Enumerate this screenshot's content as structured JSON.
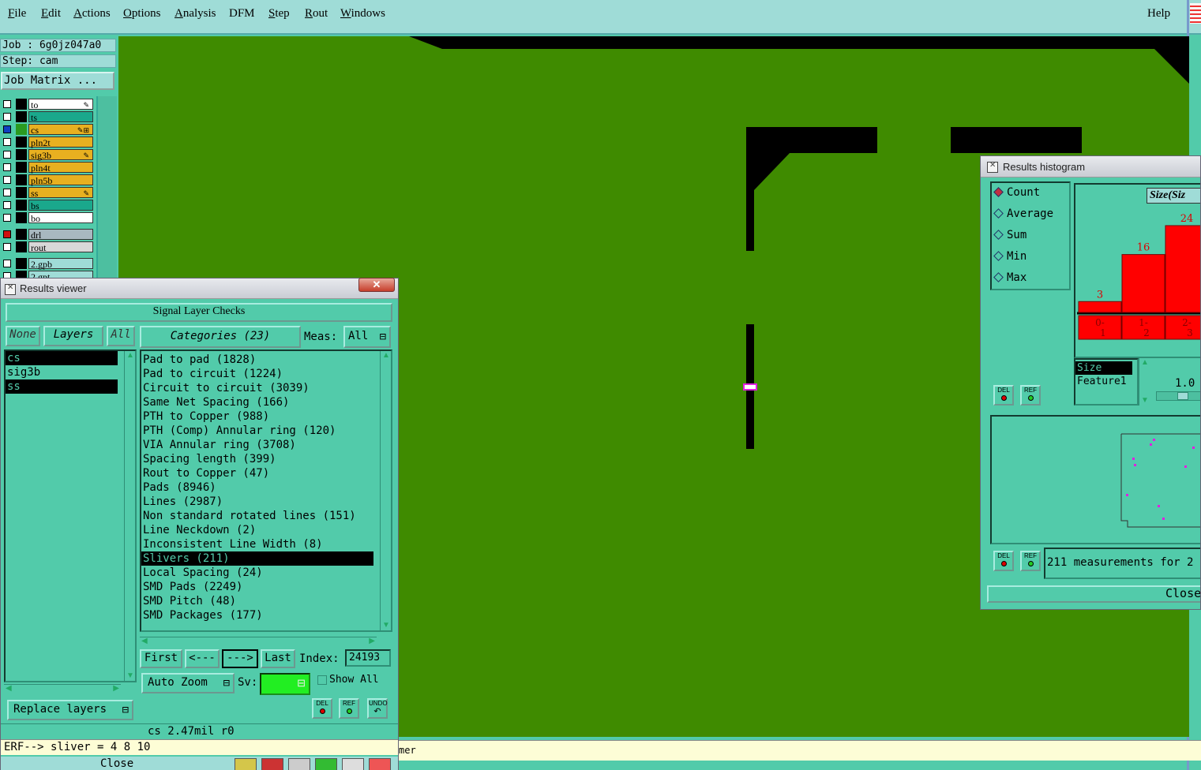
{
  "menubar": {
    "items": [
      {
        "label": "File",
        "ul": "F",
        "rest": "ile"
      },
      {
        "label": "Edit",
        "ul": "E",
        "rest": "dit"
      },
      {
        "label": "Actions",
        "ul": "A",
        "rest": "ctions"
      },
      {
        "label": "Options",
        "ul": "O",
        "rest": "ptions"
      },
      {
        "label": "Analysis",
        "ul": "A",
        "rest": "nalysis"
      },
      {
        "label": "DFM",
        "ul": "",
        "rest": "DFM"
      },
      {
        "label": "Step",
        "ul": "S",
        "rest": "tep"
      },
      {
        "label": "Rout",
        "ul": "R",
        "rest": "out"
      },
      {
        "label": "Windows",
        "ul": "W",
        "rest": "indows"
      }
    ],
    "help": "Help"
  },
  "left_panel": {
    "job_line": "Job : 6g0jz047a0",
    "step_line": "Step: cam",
    "job_matrix_button": "Job Matrix ...",
    "layers": [
      {
        "name": "to",
        "color": "#ffffff",
        "mark": "✎",
        "active": false
      },
      {
        "name": "ts",
        "color": "#1aa88c",
        "mark": "",
        "active": false
      },
      {
        "name": "cs",
        "color": "#e8b020",
        "mark": "✎⊞",
        "active": true
      },
      {
        "name": "pln2t",
        "color": "#e8b020",
        "mark": "",
        "active": false
      },
      {
        "name": "sig3b",
        "color": "#e8b020",
        "mark": "✎",
        "active": false
      },
      {
        "name": "pln4t",
        "color": "#e8b020",
        "mark": "",
        "active": false
      },
      {
        "name": "pln5b",
        "color": "#e8b020",
        "mark": "",
        "active": false
      },
      {
        "name": "ss",
        "color": "#e8b020",
        "mark": "✎",
        "active": false
      },
      {
        "name": "bs",
        "color": "#1aa88c",
        "mark": "",
        "active": false
      },
      {
        "name": "bo",
        "color": "#ffffff",
        "mark": "",
        "active": false
      },
      {
        "name": "drl",
        "color": "#a8b8c0",
        "mark": "",
        "active": false
      },
      {
        "name": "rout",
        "color": "#d8d8d8",
        "mark": "",
        "active": false
      },
      {
        "name": "2.gpb",
        "color": "#9fdcd7",
        "mark": "",
        "active": false
      },
      {
        "name": "2.gpt",
        "color": "#9fdcd7",
        "mark": "",
        "active": false
      }
    ]
  },
  "results_viewer": {
    "title": "Results viewer",
    "close_x": "✕",
    "header": "Signal Layer Checks",
    "none_btn": "None",
    "layers_btn": "Layers",
    "all_btn": "All",
    "layers_list": [
      {
        "name": "cs",
        "selected": true
      },
      {
        "name": "sig3b",
        "selected": false
      },
      {
        "name": "ss",
        "selected": true
      }
    ],
    "categories_btn": "Categories (23)",
    "meas_label": "Meas:",
    "meas_value": "All",
    "categories": [
      {
        "label": "Pad to pad (1828)",
        "selected": false
      },
      {
        "label": "Pad to circuit (1224)",
        "selected": false
      },
      {
        "label": "Circuit to circuit (3039)",
        "selected": false
      },
      {
        "label": "Same Net Spacing (166)",
        "selected": false
      },
      {
        "label": "PTH to Copper (988)",
        "selected": false
      },
      {
        "label": "PTH (Comp) Annular ring (120)",
        "selected": false
      },
      {
        "label": "VIA Annular ring (3708)",
        "selected": false
      },
      {
        "label": "Spacing length (399)",
        "selected": false
      },
      {
        "label": "Rout to Copper (47)",
        "selected": false
      },
      {
        "label": "Pads (8946)",
        "selected": false
      },
      {
        "label": "Lines (2987)",
        "selected": false
      },
      {
        "label": "Non standard rotated lines (151)",
        "selected": false
      },
      {
        "label": "Line Neckdown (2)",
        "selected": false
      },
      {
        "label": "Inconsistent Line Width (8)",
        "selected": false
      },
      {
        "label": "Slivers (211)",
        "selected": true
      },
      {
        "label": "Local Spacing (24)",
        "selected": false
      },
      {
        "label": "SMD Pads (2249)",
        "selected": false
      },
      {
        "label": "SMD Pitch (48)",
        "selected": false
      },
      {
        "label": "SMD Packages (177)",
        "selected": false
      }
    ],
    "nav": {
      "first": "First",
      "prev": "<---",
      "next": "--->",
      "last": "Last",
      "index_label": "Index:",
      "index_value": "24193"
    },
    "auto_zoom": "Auto Zoom",
    "sv_label": "Sv:",
    "show_all": "Show All",
    "replace_layers": "Replace layers",
    "del": "DEL",
    "ref": "REF",
    "undo": "UNDO",
    "status": "cs 2.47mil  r0",
    "erf_line": "ERF--> sliver = 4 8 10",
    "close_btn": "Close"
  },
  "histogram": {
    "title": "Results histogram",
    "modes": [
      {
        "label": "Count",
        "on": true
      },
      {
        "label": "Average",
        "on": false
      },
      {
        "label": "Sum",
        "on": false
      },
      {
        "label": "Min",
        "on": false
      },
      {
        "label": "Max",
        "on": false
      }
    ],
    "chart_title": "Size(Siz",
    "bars": [
      {
        "value": "3",
        "range_top": "0-",
        "range_bot": "1",
        "level": 0.125
      },
      {
        "value": "16",
        "range_top": "1-",
        "range_bot": "2",
        "level": 0.667
      },
      {
        "value": "24",
        "range_top": "2-",
        "range_bot": "3",
        "level": 1.0
      }
    ],
    "fields": [
      {
        "name": "Size",
        "selected": true
      },
      {
        "name": "Feature1",
        "selected": false
      }
    ],
    "step_value": "1.0",
    "del": "DEL",
    "ref": "REF",
    "summary": "211 measurements for 2",
    "close_btn": "Close"
  },
  "cmdline": {
    "text": "mer"
  }
}
